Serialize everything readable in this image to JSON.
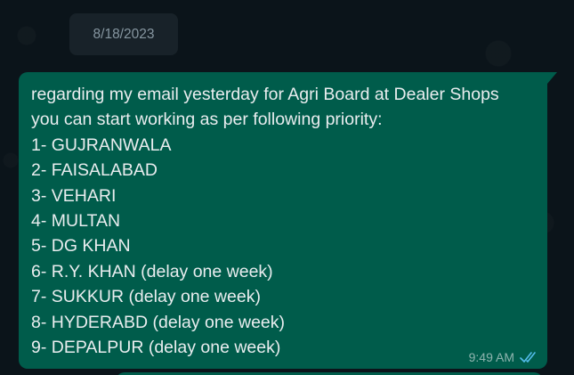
{
  "date_chip": "8/18/2023",
  "message": {
    "lines": [
      "regarding my email yesterday for Agri Board at Dealer Shops",
      "you can start working as per following priority:",
      "1- GUJRANWALA",
      "2- FAISALABAD",
      "3- VEHARI",
      "4- MULTAN",
      "5- DG KHAN",
      "6- R.Y. KHAN (delay one week)",
      "7- SUKKUR (delay one week)",
      "8- HYDERABD (delay one week)",
      "9- DEPALPUR (delay one week)"
    ],
    "time": "9:49 AM",
    "status_icon": "double-check-read-icon"
  },
  "colors": {
    "background": "#0b141a",
    "outgoing_bubble": "#005c4b",
    "date_chip": "#182229",
    "read_ticks": "#53bdeb"
  }
}
